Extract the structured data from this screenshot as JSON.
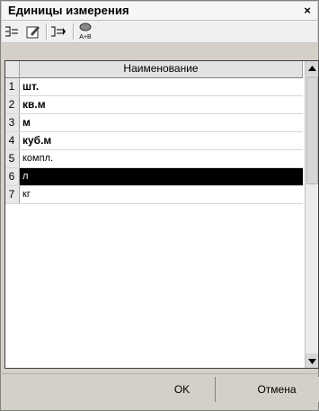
{
  "window": {
    "title": "Единицы измерения",
    "close_label": "×"
  },
  "toolbar": {
    "buttons": [
      {
        "icon": "insert-row-icon"
      },
      {
        "icon": "edit-icon"
      },
      {
        "icon": "move-row-icon"
      },
      {
        "icon": "sort-icon",
        "label": "A+B"
      }
    ]
  },
  "grid": {
    "column_header": "Наименование",
    "rows": [
      {
        "num": "1",
        "name": "шт.",
        "bold": true
      },
      {
        "num": "2",
        "name": "кв.м",
        "bold": true
      },
      {
        "num": "3",
        "name": "м",
        "bold": true
      },
      {
        "num": "4",
        "name": "куб.м",
        "bold": true
      },
      {
        "num": "5",
        "name": "компл.",
        "bold": false
      },
      {
        "num": "6",
        "name": "л",
        "bold": false,
        "selected": true
      },
      {
        "num": "7",
        "name": "кг",
        "bold": false
      }
    ]
  },
  "buttons": {
    "ok": "OK",
    "cancel": "Отмена"
  },
  "colors": {
    "selection": "#000000",
    "background": "#d4d0c8"
  }
}
